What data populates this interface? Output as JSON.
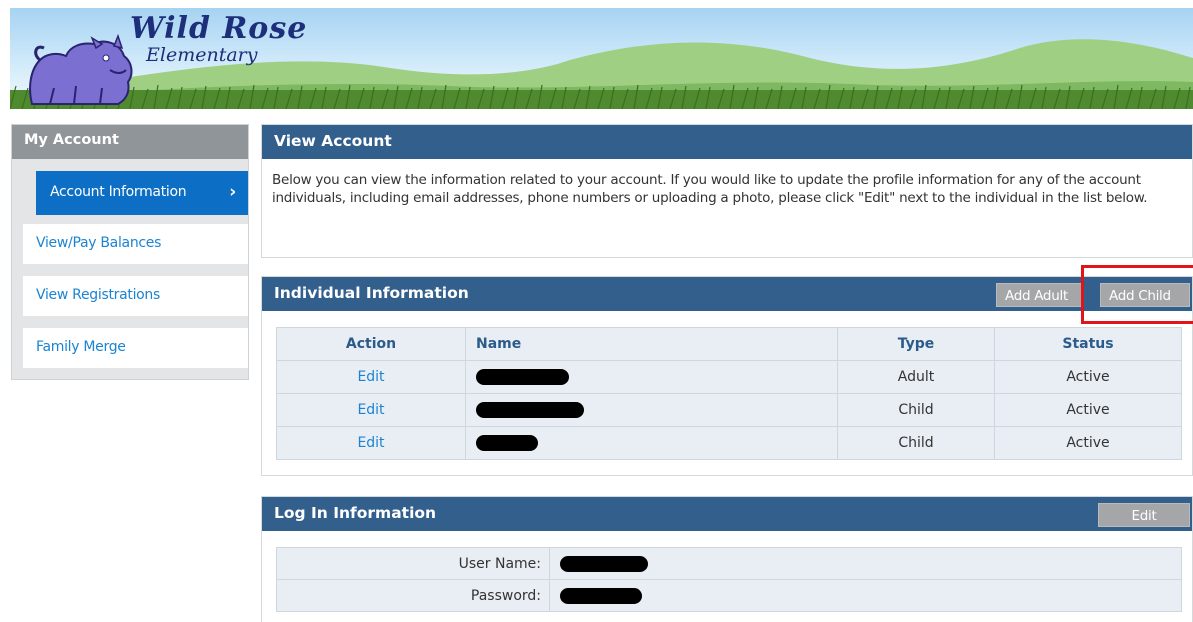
{
  "banner": {
    "school_line1": "Wild Rose",
    "school_line2": "Elementary",
    "mascot": "cougar-mascot-icon"
  },
  "sidebar": {
    "title": "My Account",
    "items": [
      {
        "label": "Account Information",
        "active": true
      },
      {
        "label": "View/Pay Balances",
        "active": false
      },
      {
        "label": "View Registrations",
        "active": false
      },
      {
        "label": "Family Merge",
        "active": false
      }
    ],
    "chevron": "›"
  },
  "view_account": {
    "title": "View Account",
    "description": "Below you can view the information related to your account. If you would like to update the profile information for any of the account individuals, including email addresses, phone numbers or uploading a photo, please click \"Edit\" next to the individual in the list below."
  },
  "individuals": {
    "title": "Individual Information",
    "add_adult_label": "Add Adult",
    "add_child_label": "Add Child",
    "columns": [
      "Action",
      "Name",
      "Type",
      "Status"
    ],
    "rows": [
      {
        "action": "Edit",
        "name": "[redacted]",
        "type": "Adult",
        "status": "Active"
      },
      {
        "action": "Edit",
        "name": "[redacted]",
        "type": "Child",
        "status": "Active"
      },
      {
        "action": "Edit",
        "name": "[redacted]",
        "type": "Child",
        "status": "Active"
      }
    ]
  },
  "login": {
    "title": "Log In Information",
    "edit_label": "Edit",
    "username_label": "User Name:",
    "password_label": "Password:",
    "username_value": "[redacted]",
    "password_value": "[redacted]"
  },
  "colors": {
    "panel_header": "#325f8c",
    "sidebar_active": "#0c6ec4",
    "link": "#1b84d2",
    "highlight": "#e0141a"
  }
}
